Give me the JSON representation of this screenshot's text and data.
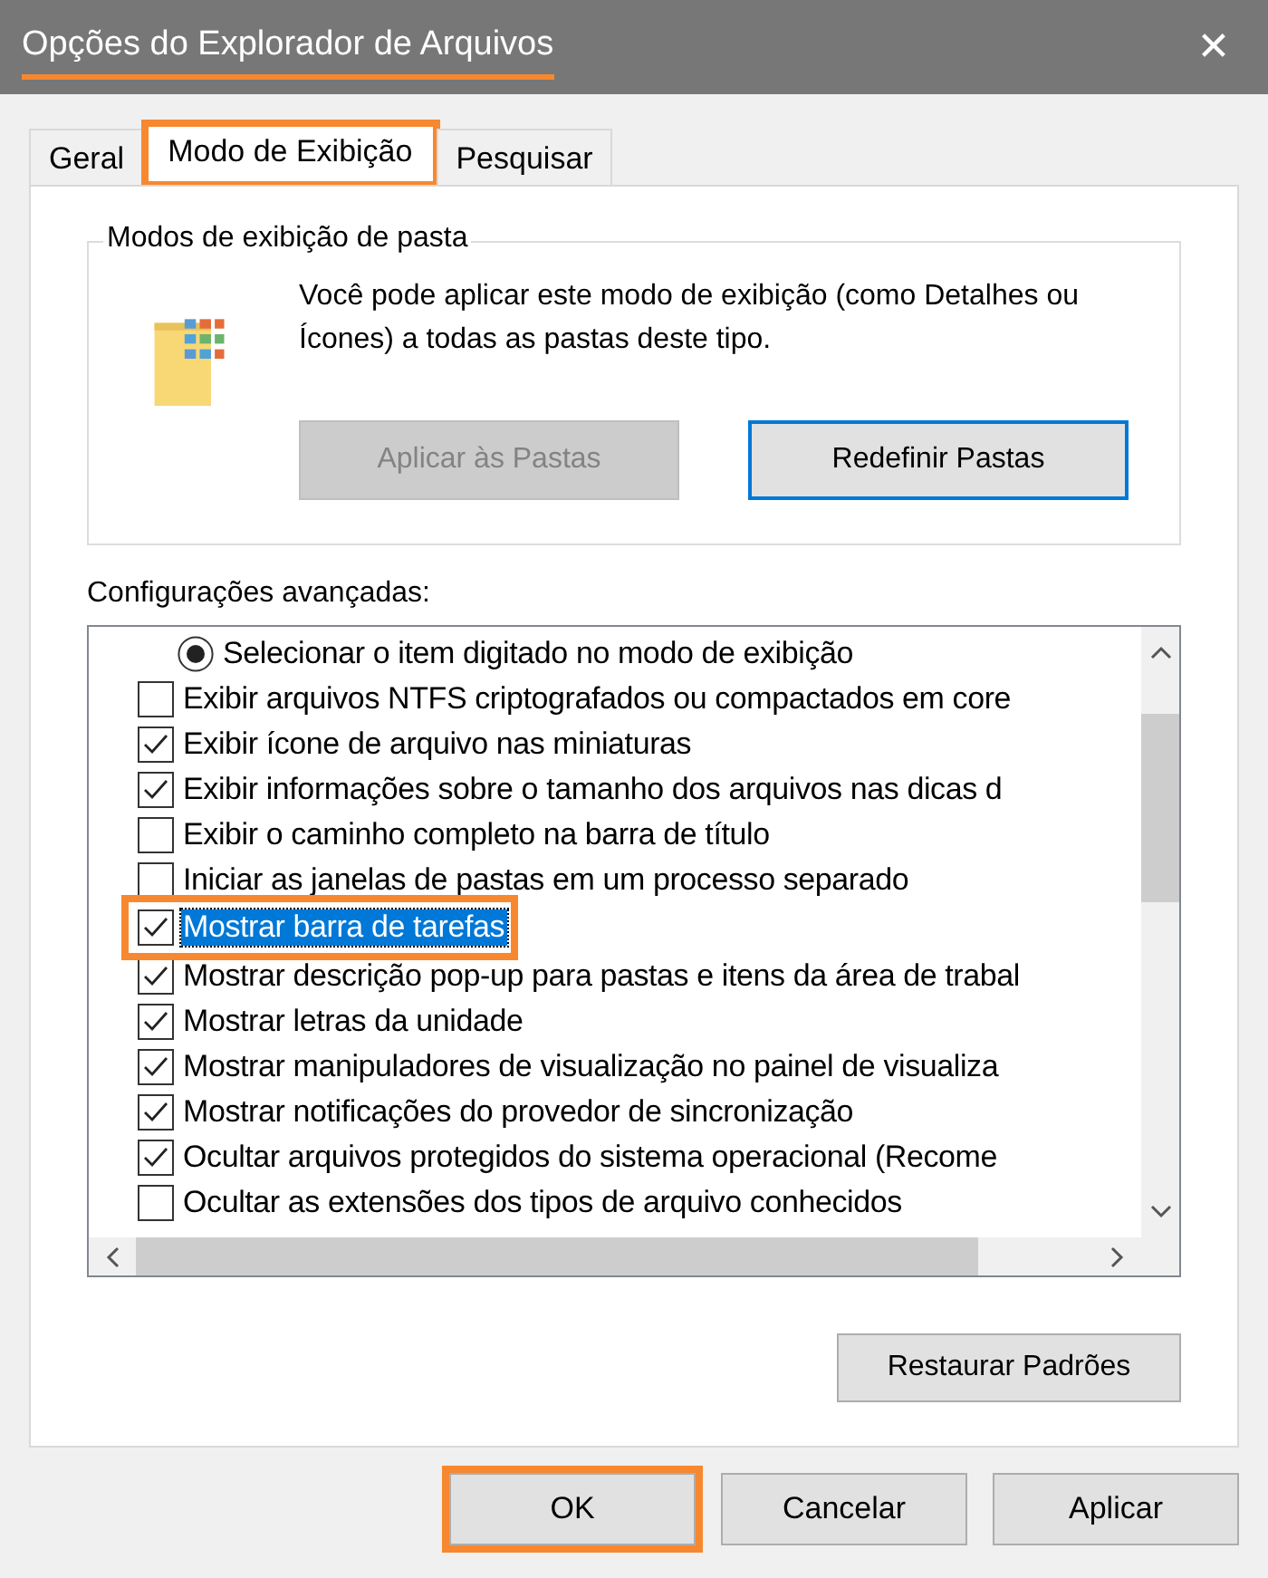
{
  "window": {
    "title": "Opções do Explorador de Arquivos",
    "title_highlighted": true,
    "close": "✕"
  },
  "tabs": [
    {
      "label": "Geral",
      "selected": false,
      "highlighted": false
    },
    {
      "label": "Modo de Exibição",
      "selected": true,
      "highlighted": true
    },
    {
      "label": "Pesquisar",
      "selected": false,
      "highlighted": false
    }
  ],
  "folder_views": {
    "title": "Modos de exibição de pasta",
    "description": "Você pode aplicar este modo de exibição (como Detalhes ou Ícones) a todas as pastas deste tipo.",
    "buttons": [
      {
        "label": "Aplicar às Pastas",
        "disabled": true,
        "focused": false
      },
      {
        "label": "Redefinir Pastas",
        "disabled": false,
        "focused": true
      }
    ]
  },
  "advanced": {
    "title": "Configurações avançadas:",
    "items": [
      {
        "kind": "radio",
        "label": "Selecionar o item digitado no modo de exibição",
        "checked": true,
        "selected": false,
        "highlighted": false
      },
      {
        "kind": "checkbox",
        "label": "Exibir arquivos NTFS criptografados ou compactados em core",
        "checked": false,
        "selected": false,
        "highlighted": false
      },
      {
        "kind": "checkbox",
        "label": "Exibir ícone de arquivo nas miniaturas",
        "checked": true,
        "selected": false,
        "highlighted": false
      },
      {
        "kind": "checkbox",
        "label": "Exibir informações sobre o tamanho dos arquivos nas dicas d",
        "checked": true,
        "selected": false,
        "highlighted": false
      },
      {
        "kind": "checkbox",
        "label": "Exibir o caminho completo na barra de título",
        "checked": false,
        "selected": false,
        "highlighted": false
      },
      {
        "kind": "checkbox",
        "label": "Iniciar as janelas de pastas em um processo separado",
        "checked": false,
        "selected": false,
        "highlighted": false
      },
      {
        "kind": "checkbox",
        "label": "Mostrar barra de tarefas",
        "checked": true,
        "selected": true,
        "highlighted": true
      },
      {
        "kind": "checkbox",
        "label": "Mostrar descrição pop-up para pastas e itens da área de trabal",
        "checked": true,
        "selected": false,
        "highlighted": false
      },
      {
        "kind": "checkbox",
        "label": "Mostrar letras da unidade",
        "checked": true,
        "selected": false,
        "highlighted": false
      },
      {
        "kind": "checkbox",
        "label": "Mostrar manipuladores de visualização no painel de visualiza",
        "checked": true,
        "selected": false,
        "highlighted": false
      },
      {
        "kind": "checkbox",
        "label": "Mostrar notificações do provedor de sincronização",
        "checked": true,
        "selected": false,
        "highlighted": false
      },
      {
        "kind": "checkbox",
        "label": "Ocultar arquivos protegidos do sistema operacional (Recome",
        "checked": true,
        "selected": false,
        "highlighted": false
      },
      {
        "kind": "checkbox",
        "label": "Ocultar as extensões dos tipos de arquivo conhecidos",
        "checked": false,
        "selected": false,
        "highlighted": false
      }
    ],
    "restore_button": "Restaurar Padrões"
  },
  "buttons": [
    {
      "label": "OK",
      "highlighted": true
    },
    {
      "label": "Cancelar",
      "highlighted": false
    },
    {
      "label": "Aplicar",
      "highlighted": false
    }
  ]
}
